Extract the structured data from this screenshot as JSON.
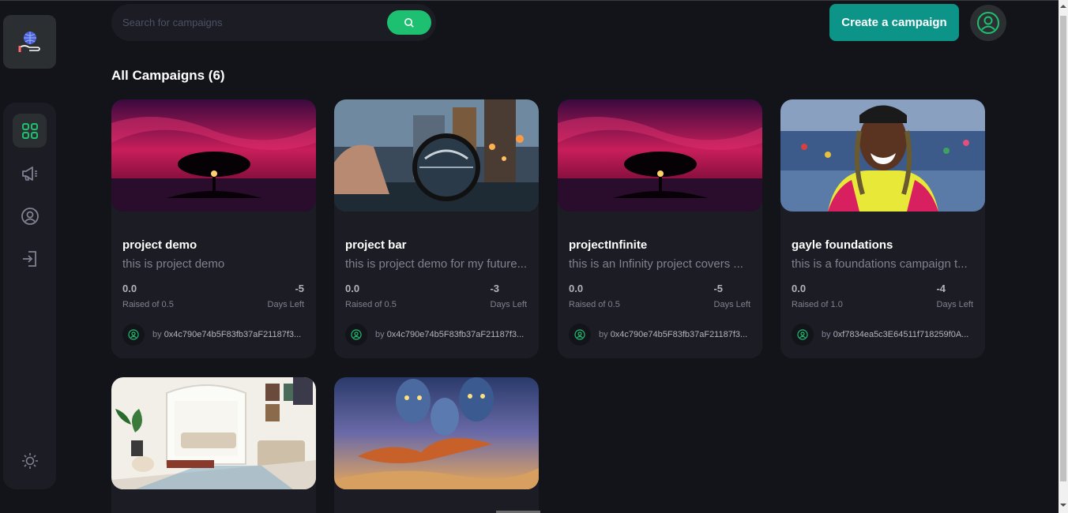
{
  "header": {
    "search_placeholder": "Search for campaigns",
    "create_label": "Create a campaign"
  },
  "sidebar": {
    "items": [
      {
        "icon": "dashboard-icon",
        "active": true
      },
      {
        "icon": "campaign-icon",
        "active": false
      },
      {
        "icon": "profile-icon",
        "active": false
      },
      {
        "icon": "logout-icon",
        "active": false
      }
    ],
    "theme_icon": "sun-icon"
  },
  "main": {
    "title": "All Campaigns (6)",
    "cards": [
      {
        "title": "project demo",
        "description": "this is project demo",
        "raised": "0.0",
        "raised_label": "Raised of 0.5",
        "days": "-5",
        "days_label": "Days Left",
        "owner_prefix": "by ",
        "owner": "0x4c790e74b5F83fb37aF21187f3...",
        "image": "sunset-tree"
      },
      {
        "title": "project bar",
        "description": "this is project demo for my future...",
        "raised": "0.0",
        "raised_label": "Raised of 0.5",
        "days": "-3",
        "days_label": "Days Left",
        "owner_prefix": "by ",
        "owner": "0x4c790e74b5F83fb37aF21187f3...",
        "image": "lens-city"
      },
      {
        "title": "projectInfinite",
        "description": "this is an Infinity project covers ...",
        "raised": "0.0",
        "raised_label": "Raised of 0.5",
        "days": "-5",
        "days_label": "Days Left",
        "owner_prefix": "by ",
        "owner": "0x4c790e74b5F83fb37aF21187f3...",
        "image": "sunset-tree"
      },
      {
        "title": "gayle foundations",
        "description": "this is a foundations campaign t...",
        "raised": "0.0",
        "raised_label": "Raised of 1.0",
        "days": "-4",
        "days_label": "Days Left",
        "owner_prefix": "by ",
        "owner": "0xf7834ea5c3E64511f718259f0A...",
        "image": "portrait"
      },
      {
        "title": "",
        "description": "",
        "raised": "",
        "raised_label": "",
        "days": "",
        "days_label": "",
        "owner_prefix": "",
        "owner": "",
        "image": "living-room"
      },
      {
        "title": "",
        "description": "",
        "raised": "",
        "raised_label": "",
        "days": "",
        "days_label": "",
        "owner_prefix": "",
        "owner": "",
        "image": "fantasy-poster"
      }
    ]
  },
  "colors": {
    "background": "#13131a",
    "surface": "#1c1c24",
    "accent_green": "#1dc071",
    "create_button": "#0d9488",
    "muted_text": "#808191"
  }
}
